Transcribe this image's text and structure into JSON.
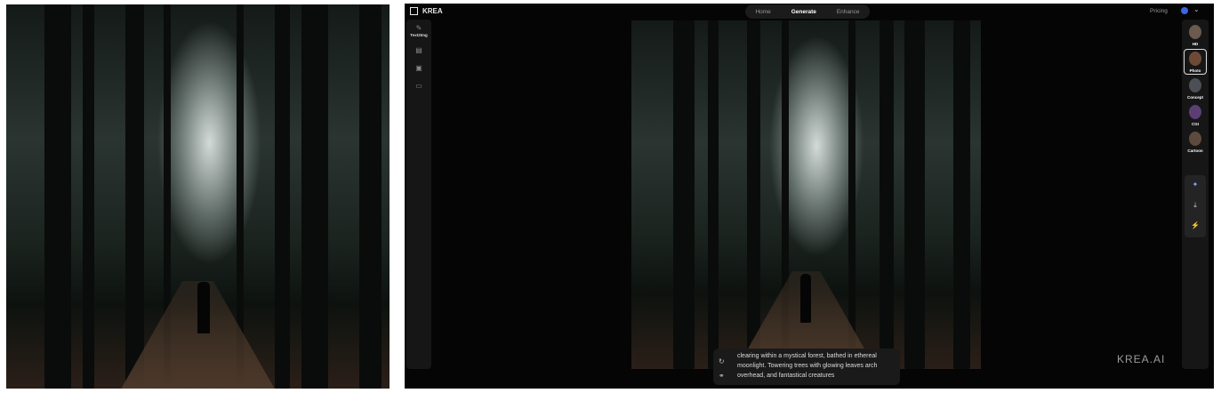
{
  "app": {
    "brand": "KREA"
  },
  "nav": {
    "tabs": [
      "Home",
      "Generate",
      "Enhance"
    ],
    "active": "Generate"
  },
  "header": {
    "pricing": "Pricing"
  },
  "left_rail": {
    "items": [
      {
        "icon": "image-gen-icon",
        "label": "Text2Img"
      },
      {
        "icon": "image-icon"
      },
      {
        "icon": "screen-icon"
      },
      {
        "icon": "video-icon"
      }
    ]
  },
  "styles": [
    {
      "label": "HD",
      "color": "#6b5a4d"
    },
    {
      "label": "Photo",
      "color": "#6e4a36"
    },
    {
      "label": "Concept",
      "color": "#4d4f57"
    },
    {
      "label": "CGI",
      "color": "#5b3f74"
    },
    {
      "label": "Cartoon",
      "color": "#5d4a3f"
    }
  ],
  "tools": [
    "sparkle-icon",
    "download-icon",
    "magic-wand-icon"
  ],
  "prompt": {
    "text": "clearing within a mystical forest, bathed in ethereal moonlight. Towering trees with glowing leaves arch overhead, and fantastical creatures"
  },
  "watermark": "KREA.AI"
}
